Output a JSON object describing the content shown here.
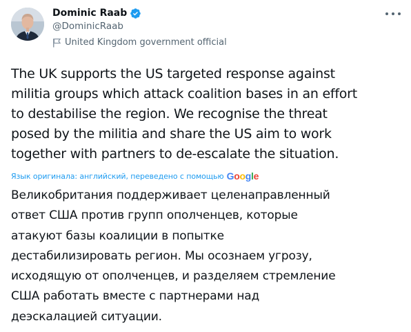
{
  "author": {
    "name": "Dominic Raab",
    "handle": "@DominicRaab",
    "label": "United Kingdom government official"
  },
  "tweet": {
    "text": "The UK supports the US targeted response against\nmilitia groups which attack coalition bases in an effort\nto destabilise the region. We recognise the threat\nposed by the militia and share the US aim to work\ntogether with partners to de-escalate the situation."
  },
  "translation": {
    "label": "Язык оригинала: английский, переведено с помощью",
    "provider_letters": [
      "G",
      "o",
      "o",
      "g",
      "l",
      "e"
    ],
    "text": "Великобритания поддерживает целенаправленный\nответ США против групп ополченцев, которые\nатакуют базы коалиции в попытке\nдестабилизировать регион. Мы осознаем угрозу,\nисходящую от ополченцев, и разделяем стремление\nСША работать вместе с партнерами над\nдеэскалацией ситуации."
  },
  "colors": {
    "text": "#0f1419",
    "secondary": "#536471",
    "link": "#1d9bf0",
    "verified": "#1d9bf0",
    "google": [
      "#4285f4",
      "#ea4335",
      "#fbbc05",
      "#4285f4",
      "#34a853",
      "#ea4335"
    ]
  },
  "icons": {
    "verified": "verified-badge-icon",
    "label": "flag-icon",
    "more": "more-icon"
  }
}
